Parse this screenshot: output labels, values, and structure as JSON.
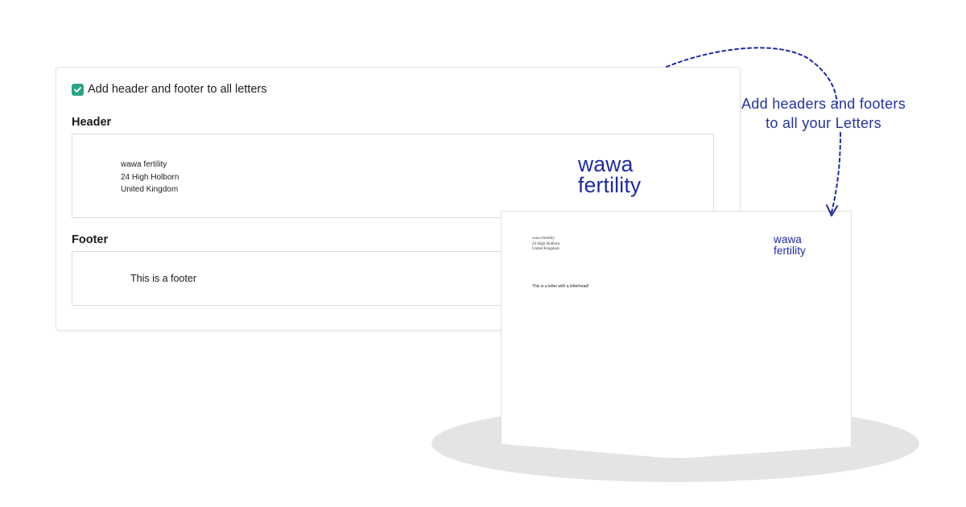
{
  "settings": {
    "checkbox_label": "Add header and footer to all letters",
    "checkbox_checked": true,
    "header_title": "Header",
    "footer_title": "Footer"
  },
  "header": {
    "address_lines": [
      "wawa fertility",
      "24 High Holborn",
      "United Kingdom"
    ],
    "logo_line1": "wawa",
    "logo_line2": "fertility"
  },
  "footer": {
    "text": "This is a footer"
  },
  "letter_preview": {
    "address_lines": [
      "wawa fertility",
      "24 High Holborn",
      "United Kingdom"
    ],
    "logo_line1": "wawa",
    "logo_line2": "fertility",
    "body_text": "This is a letter with a letterhead!"
  },
  "annotation": {
    "line1": "Add headers and footers",
    "line2": "to all your Letters"
  },
  "colors": {
    "accent_green": "#2aa487",
    "brand_blue": "#1d2aa6",
    "annotation_blue": "#2233a0"
  },
  "icons": {
    "checkbox": "check-icon",
    "arrow": "dashed-curved-arrow-icon"
  }
}
